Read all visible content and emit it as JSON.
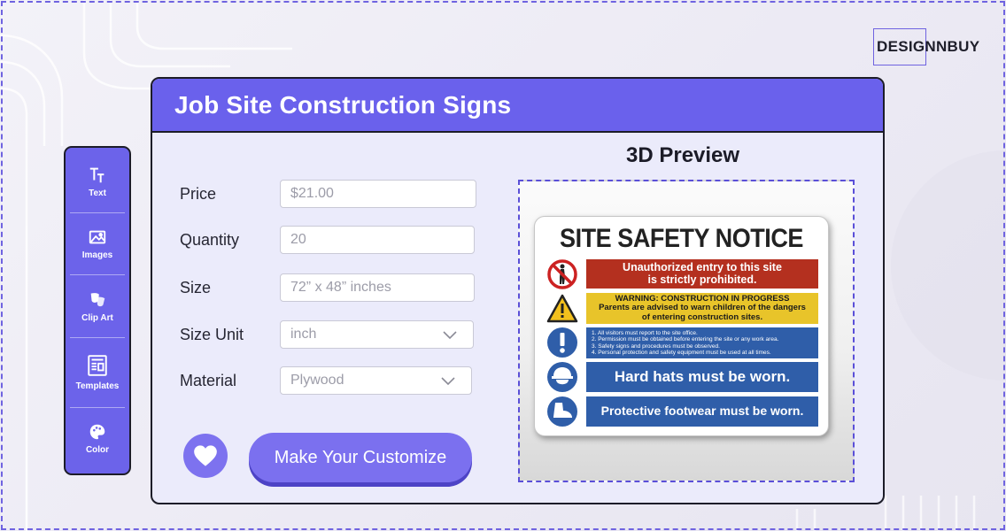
{
  "brand": {
    "name": "DESIGNNBUY"
  },
  "toolbar": {
    "items": [
      {
        "label": "Text",
        "icon": "text-icon"
      },
      {
        "label": "Images",
        "icon": "image-icon"
      },
      {
        "label": "Clip Art",
        "icon": "clip-art-icon"
      },
      {
        "label": "Templates",
        "icon": "templates-icon"
      },
      {
        "label": "Color",
        "icon": "color-palette-icon"
      }
    ]
  },
  "product": {
    "title": "Job Site Construction Signs",
    "fields": {
      "price": {
        "label": "Price",
        "placeholder": "$21.00"
      },
      "quantity": {
        "label": "Quantity",
        "placeholder": "20"
      },
      "size": {
        "label": "Size",
        "placeholder": "72” x 48” inches"
      },
      "size_unit": {
        "label": "Size Unit",
        "value": "inch"
      },
      "material": {
        "label": "Material",
        "value": "Plywood"
      }
    },
    "favorite_icon": "heart-icon",
    "customize_label": "Make Your Customize"
  },
  "preview": {
    "title": "3D Preview",
    "sign": {
      "title": "SITE SAFETY NOTICE",
      "red_panel": [
        "Unauthorized entry to this site",
        "is strictly prohibited."
      ],
      "yellow_panel": [
        "WARNING: CONSTRUCTION IN PROGRESS",
        "Parents are advised to warn children of the dangers",
        "of entering construction sites."
      ],
      "rules": [
        "1.  All visitors must report to the site office.",
        "2.  Permission must be obtained before entering the site or any work area.",
        "3.  Safety signs and procedures must be observed.",
        "4.  Personal protection and safety equipment must be used at all times."
      ],
      "hard_hats": "Hard hats must be worn.",
      "footwear": "Protective footwear must be worn."
    }
  },
  "colors": {
    "accent": "#6a61ec",
    "sign_red": "#b4301f",
    "sign_yellow": "#e8c42a",
    "sign_blue": "#2f5ea9"
  }
}
